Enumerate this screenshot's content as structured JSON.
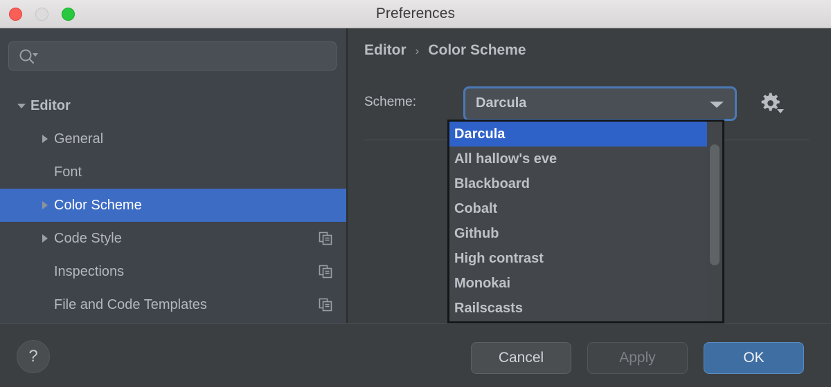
{
  "window": {
    "title": "Preferences",
    "controls": [
      {
        "name": "close",
        "color": "#fa5f57"
      },
      {
        "name": "minimize",
        "color": "#dcdcdc"
      },
      {
        "name": "maximize",
        "color": "#28c840"
      }
    ]
  },
  "sidebar": {
    "search": {
      "value": "",
      "placeholder": "",
      "icon": "search-icon"
    },
    "tree": [
      {
        "label": "Editor",
        "indent": 0,
        "twisty": "expanded",
        "bold": true,
        "selected": false,
        "copy_icon": false
      },
      {
        "label": "General",
        "indent": 1,
        "twisty": "collapsed",
        "bold": false,
        "selected": false,
        "copy_icon": false
      },
      {
        "label": "Font",
        "indent": 1,
        "twisty": "none",
        "bold": false,
        "selected": false,
        "copy_icon": false
      },
      {
        "label": "Color Scheme",
        "indent": 1,
        "twisty": "collapsed",
        "bold": false,
        "selected": true,
        "copy_icon": false
      },
      {
        "label": "Code Style",
        "indent": 1,
        "twisty": "collapsed",
        "bold": false,
        "selected": false,
        "copy_icon": true
      },
      {
        "label": "Inspections",
        "indent": 1,
        "twisty": "none",
        "bold": false,
        "selected": false,
        "copy_icon": true
      },
      {
        "label": "File and Code Templates",
        "indent": 1,
        "twisty": "none",
        "bold": false,
        "selected": false,
        "copy_icon": true
      }
    ]
  },
  "main": {
    "breadcrumb": {
      "root": "Editor",
      "separator": "›",
      "leaf": "Color Scheme"
    },
    "scheme": {
      "label": "Scheme:",
      "selected": "Darcula",
      "gear_icon": "gear-icon",
      "dropdown_open": true,
      "options": [
        "Darcula",
        "All hallow's eve",
        "Blackboard",
        "Cobalt",
        "Github",
        "High contrast",
        "Monokai",
        "Railscasts"
      ]
    }
  },
  "footer": {
    "help_label": "?",
    "cancel_label": "Cancel",
    "apply_label": "Apply",
    "ok_label": "OK",
    "apply_enabled": false
  },
  "colors": {
    "accent_blue": "#3d6cc4",
    "selection_blue": "#2f62c9",
    "ok_button_blue": "#3f6ea3",
    "focus_ring": "#4a79b5",
    "sidebar_bg": "#3f434a",
    "panel_bg": "#3c3f41",
    "text": "#b3b8bd"
  }
}
